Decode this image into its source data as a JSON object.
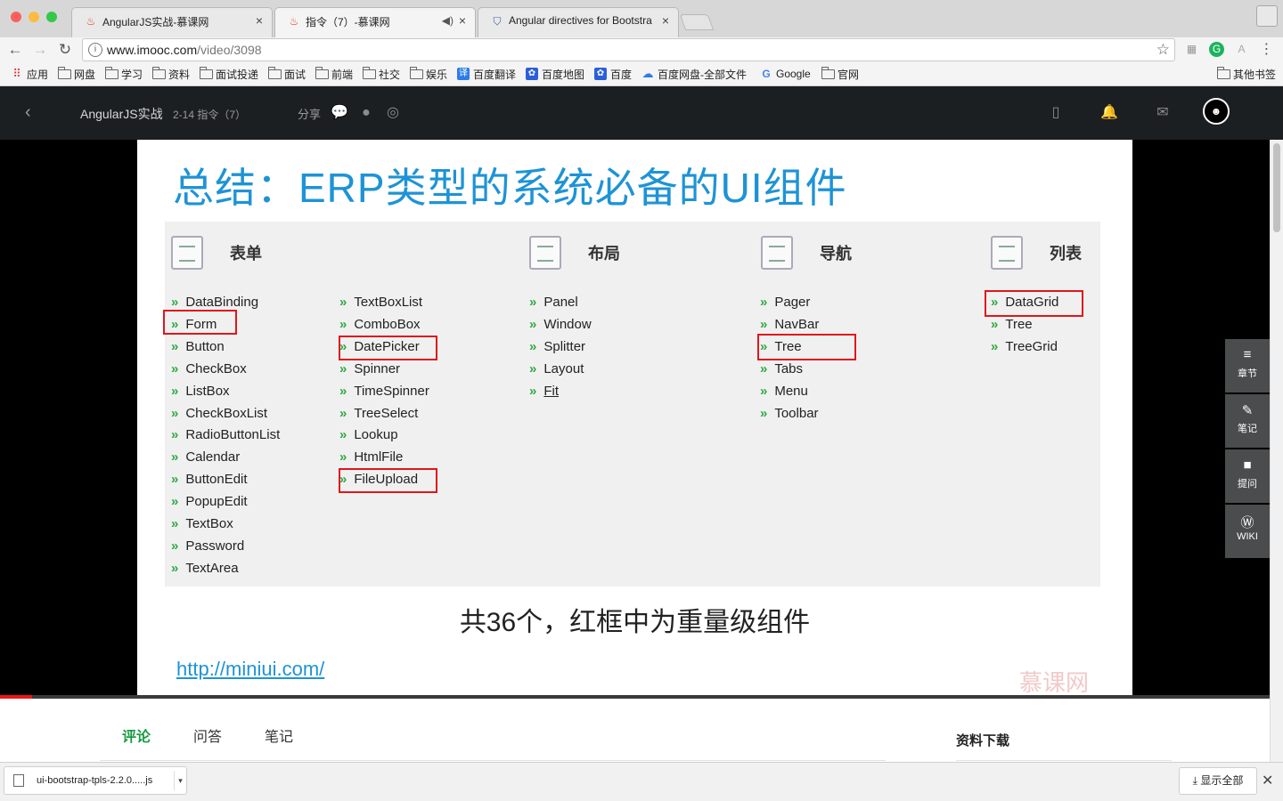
{
  "browser": {
    "tabs": [
      {
        "title": "AngularJS实战-慕课网",
        "icon": "flame-icon"
      },
      {
        "title": "指令（7）-慕课网",
        "icon": "flame-icon",
        "audio": "speaker-icon"
      },
      {
        "title": "Angular directives for Bootstra",
        "icon": "shield-icon"
      }
    ],
    "url_host": "www.imooc.com",
    "url_path": "/video/3098",
    "bookmarks": [
      "应用",
      "网盘",
      "学习",
      "资料",
      "面试投递",
      "面试",
      "前端",
      "社交",
      "娱乐",
      "百度翻译",
      "百度地图",
      "百度",
      "百度网盘-全部文件",
      "Google",
      "官网"
    ],
    "other_bookmarks": "其他书签"
  },
  "site": {
    "course": "AngularJS实战",
    "lesson": "2-14 指令（7）",
    "share": "分享"
  },
  "slide": {
    "title": "总结：ERP类型的系统必备的UI组件",
    "headers": [
      "表单",
      "布局",
      "导航",
      "列表"
    ],
    "col_form_a": [
      "DataBinding",
      "Form",
      "Button",
      "CheckBox",
      "ListBox",
      "CheckBoxList",
      "RadioButtonList",
      "Calendar",
      "ButtonEdit",
      "PopupEdit",
      "TextBox",
      "Password",
      "TextArea"
    ],
    "col_form_b": [
      "TextBoxList",
      "ComboBox",
      "DatePicker",
      "Spinner",
      "TimeSpinner",
      "TreeSelect",
      "Lookup",
      "HtmlFile",
      "FileUpload"
    ],
    "col_layout": [
      "Panel",
      "Window",
      "Splitter",
      "Layout",
      "Fit"
    ],
    "col_nav": [
      "Pager",
      "NavBar",
      "Tree",
      "Tabs",
      "Menu",
      "Toolbar"
    ],
    "col_list": [
      "DataGrid",
      "Tree",
      "TreeGrid"
    ],
    "arrow": "»",
    "highlighted": [
      "Form",
      "DatePicker",
      "FileUpload",
      "Tree",
      "DataGrid"
    ],
    "bottom_text": "共36个，红框中为重量级组件",
    "link": "http://miniui.com/",
    "watermark": "慕课网"
  },
  "side_panel": [
    {
      "label": "章节",
      "icon": "list-icon"
    },
    {
      "label": "笔记",
      "icon": "pencil-icon"
    },
    {
      "label": "提问",
      "icon": "question-bubble-icon"
    },
    {
      "label": "WIKI",
      "icon": "wiki-icon"
    }
  ],
  "content": {
    "tabs": [
      "评论",
      "问答",
      "笔记"
    ],
    "download_heading": "资料下载"
  },
  "downloads": {
    "file": "ui-bootstrap-tpls-2.2.0.....js",
    "show_all": "显示全部"
  },
  "colors": {
    "title_blue": "#1e93d6",
    "highlight_red": "#e0161b",
    "arrow_green": "#2da844",
    "active_tab_green": "#1a9b43",
    "header_dark": "#1c1f21"
  }
}
